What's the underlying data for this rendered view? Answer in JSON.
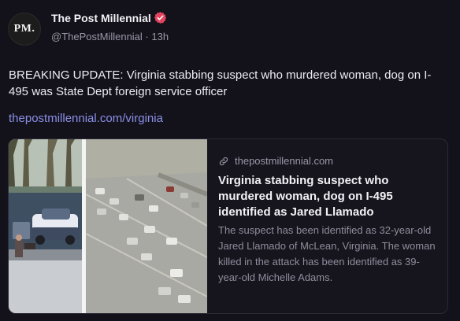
{
  "account": {
    "avatar_text": "PM.",
    "display_name": "The Post Millennial",
    "handle": "@ThePostMillennial",
    "separator": " · ",
    "time_ago": "13h",
    "verified_icon": "verified-badge-icon"
  },
  "post": {
    "text": "BREAKING UPDATE: Virginia stabbing suspect who murdered woman, dog on I-495 was State Dept foreign service officer",
    "link_text": "thepostmillennial.com/virginia"
  },
  "card": {
    "domain": "thepostmillennial.com",
    "domain_icon": "link-icon",
    "title": "Virginia stabbing suspect who murdered woman, dog on I-495 identified as Jared Llamado",
    "description": "The suspect has been identified as 32-year-old Jared Llamado of McLean, Virginia. The woman killed in the attack has been identified as 39-year-old Michelle Adams.",
    "thumbnail": "news-photos-thumbnail"
  },
  "colors": {
    "background": "#13121a",
    "link": "#8b8fe8",
    "verified": "#e2445f",
    "muted": "#9a98a8"
  }
}
